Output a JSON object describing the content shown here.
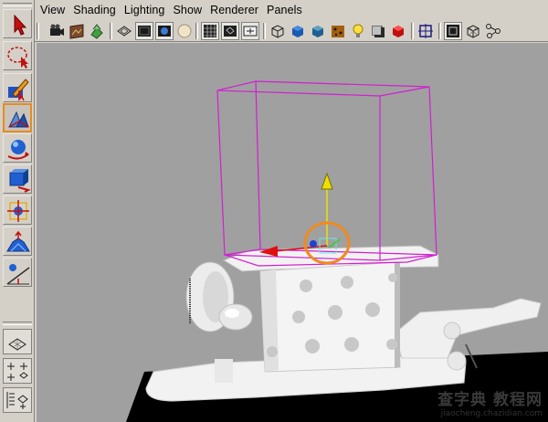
{
  "menubar": {
    "items": [
      "View",
      "Shading",
      "Lighting",
      "Show",
      "Renderer",
      "Panels"
    ]
  },
  "toolbox": {
    "tools": [
      {
        "name": "select-tool-icon",
        "active": false
      },
      {
        "name": "lasso-tool-icon",
        "active": false
      },
      {
        "name": "paint-select-tool-icon",
        "active": false
      },
      {
        "name": "move-tool-icon",
        "active": true
      },
      {
        "name": "rotate-tool-icon",
        "active": false
      },
      {
        "name": "scale-tool-icon",
        "active": false
      },
      {
        "name": "universal-manipulator-icon",
        "active": false
      },
      {
        "name": "soft-modification-icon",
        "active": false
      },
      {
        "name": "show-manipulator-icon",
        "active": false
      }
    ]
  },
  "toolbar": {
    "icons": [
      "camera-attributes-icon",
      "image-plane-icon",
      "bookmarks-icon",
      "camera-tools-icon",
      "wireframe-on-shaded-icon",
      "xray-icon",
      "use-default-material-icon",
      "smooth-shade-icon",
      "grid-icon",
      "film-gate-icon",
      "resolution-gate-icon",
      "safe-action-icon",
      "wireframe-icon",
      "smooth-shade-all-icon",
      "flat-shade-icon",
      "textured-icon",
      "lights-icon",
      "shadows-icon",
      "isolate-select-icon",
      "high-quality-icon",
      "xray-joints-icon",
      "xray-active-icon"
    ]
  },
  "colors": {
    "viewport_bg": "#a0a0a0",
    "bounding_box": "#d21ed2",
    "highlight_ring": "#f08a1e",
    "active_tool_border": "#e88a20"
  },
  "watermark": {
    "line1": "查字典 教程网",
    "line2": "jiaocheng.chazidian.com"
  }
}
